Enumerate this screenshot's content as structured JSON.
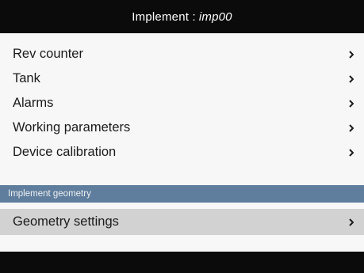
{
  "header": {
    "title_prefix": "Implement : ",
    "implement_name": "imp00"
  },
  "menu": {
    "items": [
      {
        "label": "Rev counter",
        "icon": "chevron-right-icon"
      },
      {
        "label": "Tank",
        "icon": "chevron-right-icon"
      },
      {
        "label": "Alarms",
        "icon": "chevron-right-icon"
      },
      {
        "label": "Working parameters",
        "icon": "chevron-right-icon"
      },
      {
        "label": "Device calibration",
        "icon": "chevron-right-icon"
      }
    ]
  },
  "geometry_section": {
    "header": "Implement geometry",
    "items": [
      {
        "label": "Geometry settings",
        "icon": "chevron-right-icon",
        "selected": true
      }
    ]
  },
  "colors": {
    "title_bar": "#0b0b0b",
    "section_header": "#5f7d9c",
    "selected_row": "#d2d2d2",
    "background": "#f7f7f7",
    "text": "#1b1b1b"
  }
}
